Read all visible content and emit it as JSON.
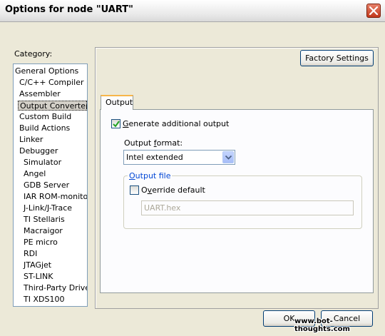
{
  "window": {
    "title": "Options for node \"UART\""
  },
  "category": {
    "label": "Category:",
    "items": [
      {
        "label": "General Options",
        "indent": 0
      },
      {
        "label": "C/C++ Compiler",
        "indent": 1
      },
      {
        "label": "Assembler",
        "indent": 1
      },
      {
        "label": "Output Converter",
        "indent": 1,
        "selected": true
      },
      {
        "label": "Custom Build",
        "indent": 1
      },
      {
        "label": "Build Actions",
        "indent": 1
      },
      {
        "label": "Linker",
        "indent": 1
      },
      {
        "label": "Debugger",
        "indent": 1
      },
      {
        "label": "Simulator",
        "indent": 2
      },
      {
        "label": "Angel",
        "indent": 2
      },
      {
        "label": "GDB Server",
        "indent": 2
      },
      {
        "label": "IAR ROM-monitor",
        "indent": 2
      },
      {
        "label": "J-Link/J-Trace",
        "indent": 2
      },
      {
        "label": "TI Stellaris",
        "indent": 2
      },
      {
        "label": "Macraigor",
        "indent": 2
      },
      {
        "label": "PE micro",
        "indent": 2
      },
      {
        "label": "RDI",
        "indent": 2
      },
      {
        "label": "JTAGjet",
        "indent": 2
      },
      {
        "label": "ST-LINK",
        "indent": 2
      },
      {
        "label": "Third-Party Driver",
        "indent": 2
      },
      {
        "label": "TI XDS100",
        "indent": 2
      }
    ]
  },
  "panel": {
    "factory_settings": "Factory Settings",
    "tab": "Output",
    "generate_additional_output": {
      "label_prefix": "",
      "label_mnemonic": "G",
      "label_rest": "enerate additional output",
      "checked": true
    },
    "output_format": {
      "label_prefix": "Output ",
      "label_mnemonic": "f",
      "label_rest": "ormat:",
      "value": "Intel extended"
    },
    "output_file": {
      "legend_prefix": "",
      "legend_mnemonic": "O",
      "legend_rest": "utput file",
      "override_prefix": "O",
      "override_mnemonic": "v",
      "override_rest": "erride default",
      "override_checked": false,
      "filename": "UART.hex"
    }
  },
  "buttons": {
    "ok": "OK",
    "cancel": "Cancel"
  },
  "watermark": "www.bot-thoughts.com"
}
